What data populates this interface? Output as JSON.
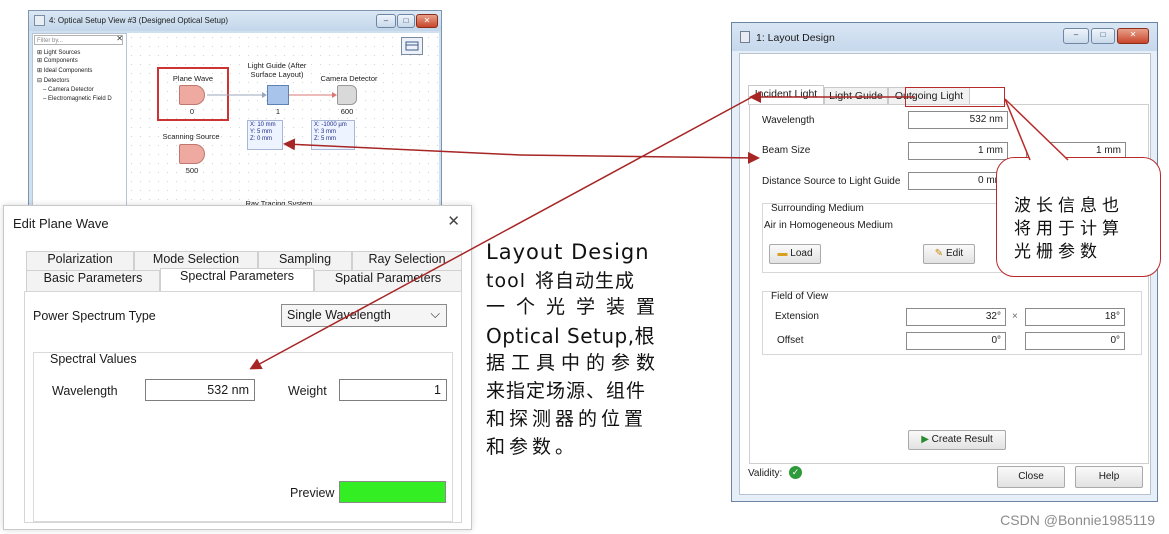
{
  "setup_window": {
    "title": "4: Optical Setup View #3 (Designed Optical Setup)",
    "filter_placeholder": "Filter by...",
    "filter_clear": "✕",
    "tree": [
      "Light Sources",
      "Components",
      "Ideal Components",
      "Detectors",
      "Camera Detector",
      "Electromagnetic Field D"
    ],
    "nodes": {
      "plane_wave": {
        "label": "Plane Wave",
        "number": "0"
      },
      "light_guide": {
        "label": "Light Guide (After Surface Layout)",
        "number": "1",
        "info": [
          "X: 10 mm",
          "Y: 5 mm",
          "Z: 0 mm"
        ]
      },
      "camera_detector": {
        "label": "Camera Detector",
        "number": "600",
        "info": [
          "X: -1000 µm",
          "Y: 3 mm",
          "Z: 5 mm"
        ]
      },
      "scanning_source": {
        "label": "Scanning Source",
        "number": "500"
      }
    },
    "bottom_labels": [
      "Ray Tracing System"
    ]
  },
  "plane_window": {
    "title": "Edit Plane Wave",
    "close": "✕",
    "tabs_row1": [
      "Polarization",
      "Mode Selection",
      "Sampling",
      "Ray Selection"
    ],
    "tabs_row2": [
      "Basic Parameters",
      "Spectral Parameters",
      "Spatial Parameters"
    ],
    "active_tab": "Spectral Parameters",
    "power_spectrum_label": "Power Spectrum Type",
    "power_spectrum_value": "Single Wavelength",
    "group_title": "Spectral Values",
    "wavelength_label": "Wavelength",
    "wavelength_value": "532 nm",
    "weight_label": "Weight",
    "weight_value": "1",
    "preview_label": "Preview",
    "preview_color": "#33ee22"
  },
  "annotation": {
    "lines": [
      "Layout Design",
      "tool 将自动生成",
      "一个光学装置",
      "Optical Setup,根",
      "据工具中的参数",
      "来指定场源、组件",
      "和探测器的位置",
      "和参数。"
    ]
  },
  "layout_window": {
    "title": "1: Layout Design",
    "tabs": [
      "Incident Light",
      "Light Guide",
      "Outgoing Light"
    ],
    "active_tab": "Incident Light",
    "wavelength_label": "Wavelength",
    "wavelength_value": "532 nm",
    "beam_size_label": "Beam Size",
    "beam_size_x": "1 mm",
    "beam_size_y": "1 mm",
    "distance_label": "Distance Source to Light Guide",
    "distance_value": "0 mm",
    "medium_group_title": "Surrounding Medium",
    "medium_value": "Air in Homogeneous Medium",
    "load_label": "Load",
    "edit_label": "Edit",
    "fov_group_title": "Field of View",
    "extension_label": "Extension",
    "extension_x": "32°",
    "extension_times": "×",
    "extension_y": "18°",
    "offset_label": "Offset",
    "offset_x": "0°",
    "offset_y": "0°",
    "create_result_label": "Create Result",
    "validity_label": "Validity:",
    "close_label": "Close",
    "help_label": "Help"
  },
  "bubble": {
    "lines": [
      "波长信息也",
      "将用于计算",
      "光栅参数"
    ]
  },
  "watermark": "CSDN @Bonnie1985119",
  "colors": {
    "highlight_red": "#b82b2b",
    "arrow_red": "#a72525",
    "validity_green": "#2e9a3a"
  }
}
